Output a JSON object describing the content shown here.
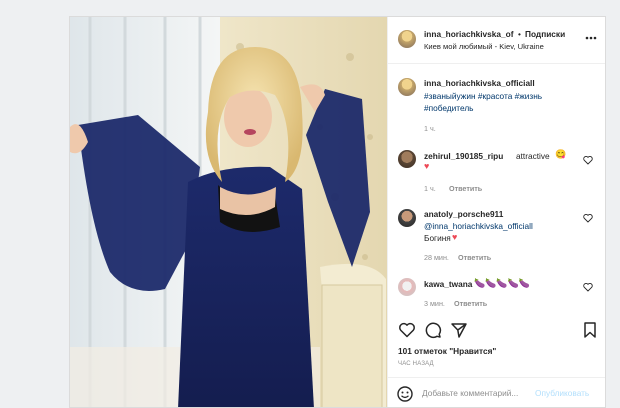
{
  "header": {
    "username": "inna_horiachkivska_of",
    "separator": "•",
    "follow_label": "Подписки",
    "location": "Киев мой любимый - Kiev, Ukraine",
    "more_icon": "more-dots-icon"
  },
  "caption": {
    "username": "inna_horiachkivska_officiall",
    "hashtags_line1": "#званыйужин #красота #жизнь",
    "hashtags_line2": "#победитель",
    "time": "1 ч."
  },
  "comments": [
    {
      "username": "zehirul_190185_ripu",
      "text": "attractive",
      "emoji": "😋",
      "time": "1 ч.",
      "reply": "Ответить"
    },
    {
      "username": "anatoly_porsche911",
      "mention": "@inna_horiachkivska_officiall",
      "text": "Богиня",
      "time": "28 мин.",
      "reply": "Ответить"
    },
    {
      "username": "kawa_twana",
      "text": "🍆🍆🍆🍆🍆",
      "time": "3 мин.",
      "reply": "Ответить"
    }
  ],
  "actions": {
    "like_icon": "heart-outline-icon",
    "comment_icon": "comment-icon",
    "share_icon": "share-icon",
    "save_icon": "bookmark-icon",
    "likes_text": "101 отметок \"Нравится\"",
    "timestamp": "ЧАС НАЗАД"
  },
  "comment_box": {
    "emoji_icon": "smiley-icon",
    "placeholder": "Добавьте комментарий...",
    "post_label": "Опубликовать"
  },
  "colors": {
    "link": "#00376b",
    "heart": "#ed4956",
    "muted": "#8e8e8e",
    "post_disabled": "#b2dffc"
  }
}
